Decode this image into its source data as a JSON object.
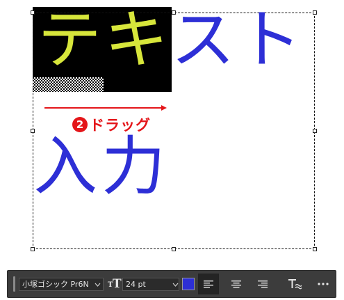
{
  "canvas": {
    "line1": {
      "selected_text": "テキ",
      "rest_text": "スト"
    },
    "line2": {
      "text": "入力"
    },
    "text_colors": {
      "selected": "#d7e63b",
      "normal": "#2d2fd6",
      "selection_background": "#000000"
    }
  },
  "annotation": {
    "step_number": "2",
    "label": "ドラッグ",
    "color": "#e4161a"
  },
  "options_bar": {
    "font_family": "小塚ゴシック Pr6N",
    "font_size_icon": "font-size-icon",
    "font_size": "24 pt",
    "text_color": "#2d2fd6",
    "alignment": "left",
    "alignment_options": [
      "left",
      "center",
      "right"
    ],
    "warp_icon": "warp-text-icon",
    "more_icon": "more-options-icon"
  }
}
